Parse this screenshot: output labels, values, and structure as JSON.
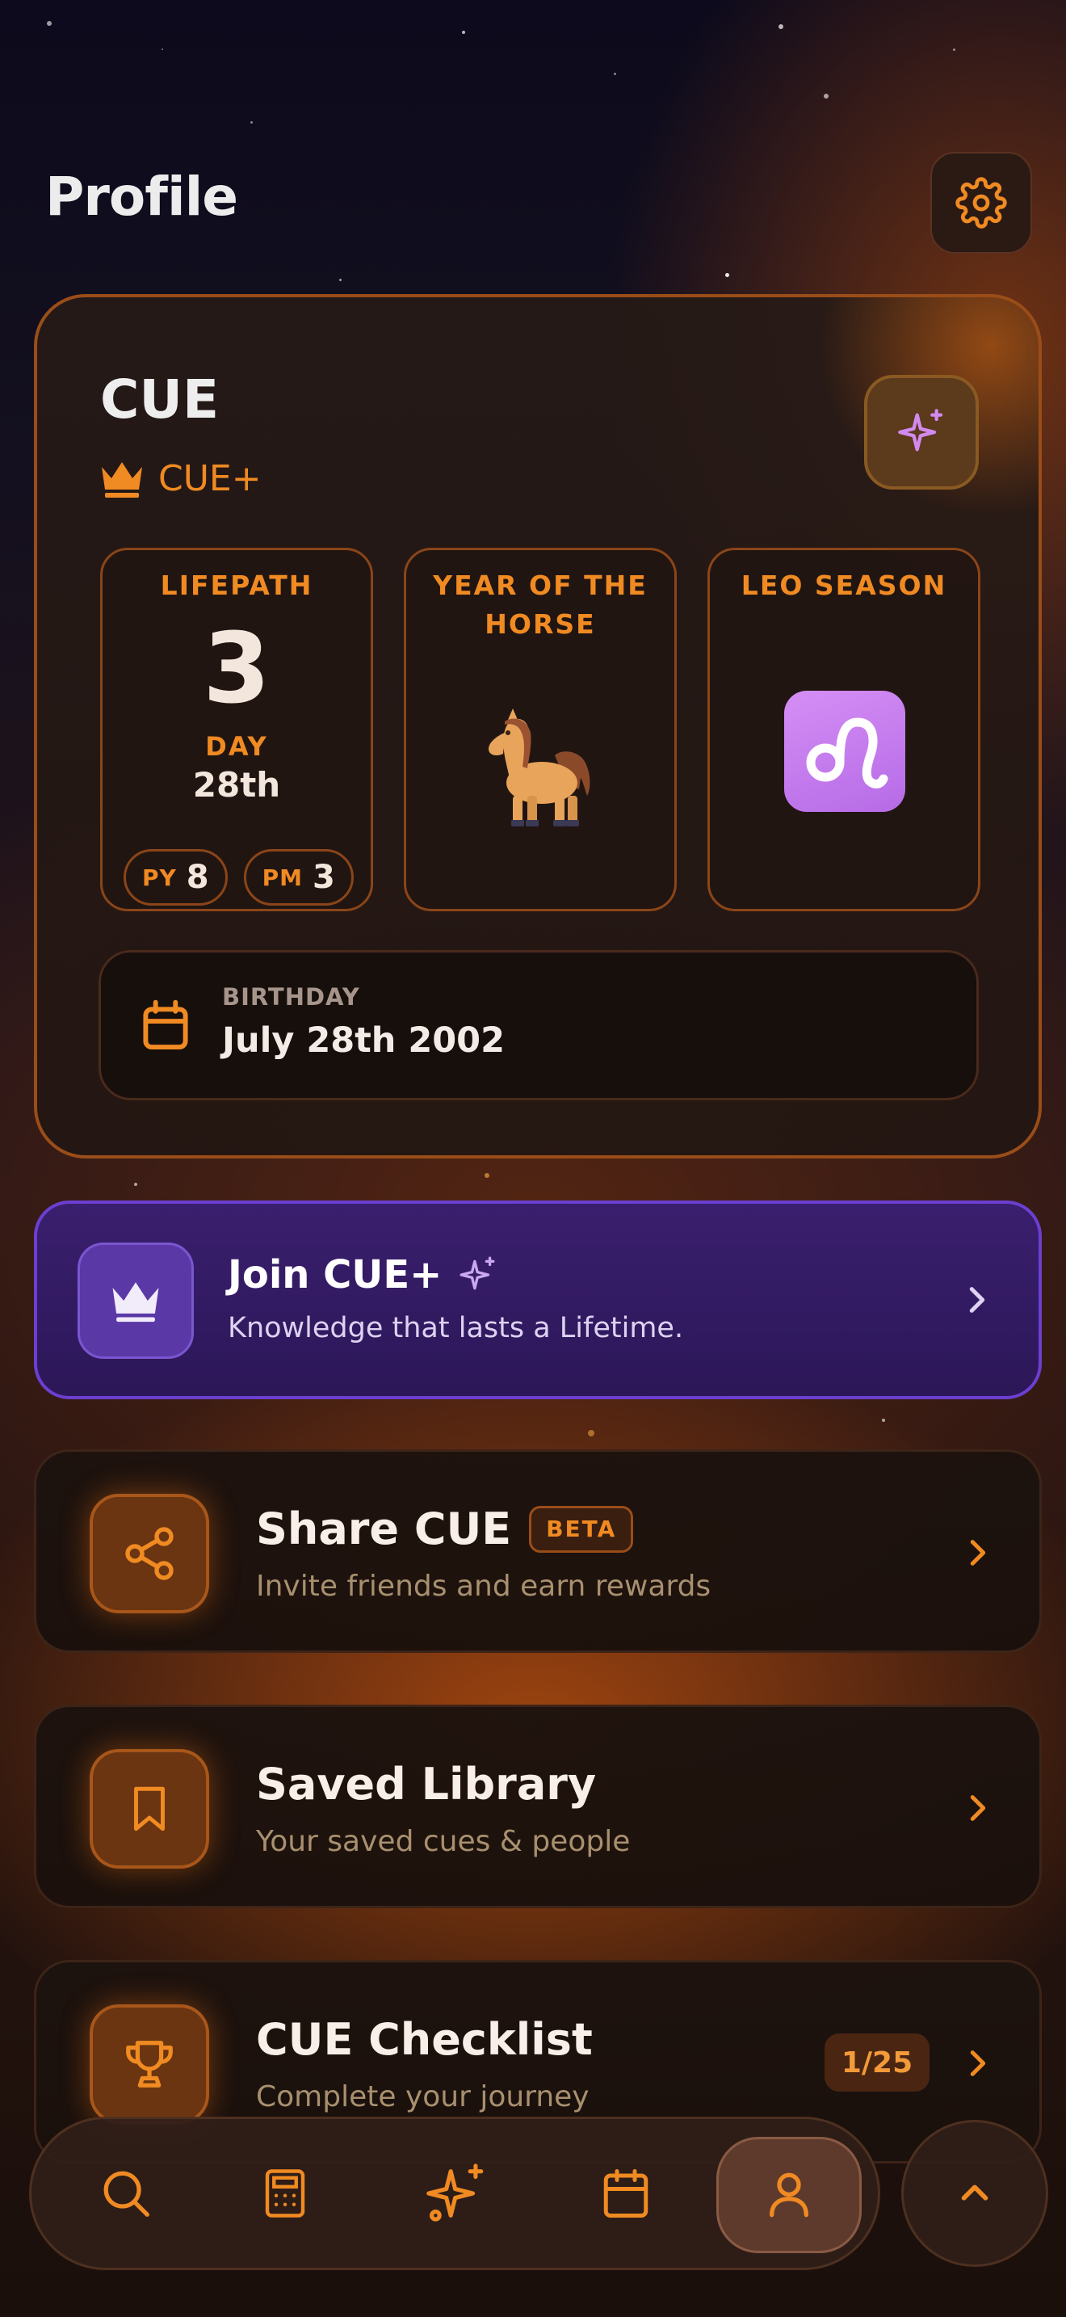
{
  "header": {
    "title": "Profile",
    "settings_icon": "gear-icon"
  },
  "profile": {
    "name": "CUE",
    "plan_label": "CUE+",
    "plan_icon": "crown-icon",
    "magic_icon": "sparkles-icon",
    "lifepath": {
      "title": "LIFEPATH",
      "number": "3",
      "day_label": "DAY",
      "day_value": "28th",
      "py_label": "PY",
      "py_value": "8",
      "pm_label": "PM",
      "pm_value": "3"
    },
    "zodiac_year": {
      "title": "YEAR OF THE HORSE",
      "icon": "horse-icon"
    },
    "season": {
      "title": "LEO SEASON",
      "icon": "leo-icon"
    },
    "birthday": {
      "label": "BIRTHDAY",
      "value": "July 28th 2002",
      "icon": "calendar-icon"
    }
  },
  "join": {
    "title": "Join CUE+",
    "subtitle": "Knowledge that lasts a Lifetime."
  },
  "menu": {
    "share": {
      "title": "Share CUE",
      "badge": "BETA",
      "subtitle": "Invite friends and earn rewards"
    },
    "library": {
      "title": "Saved Library",
      "subtitle": "Your saved cues & people"
    },
    "checklist": {
      "title": "CUE Checklist",
      "subtitle": "Complete your journey",
      "count": "1/25"
    }
  },
  "nav": {
    "items": [
      "search-icon",
      "calculator-icon",
      "sparkles-icon",
      "calendar-icon",
      "profile-icon"
    ],
    "active": "profile-icon"
  },
  "colors": {
    "accent": "#f08a22",
    "purple": "#6b3fd0",
    "text": "#f3ece6"
  }
}
